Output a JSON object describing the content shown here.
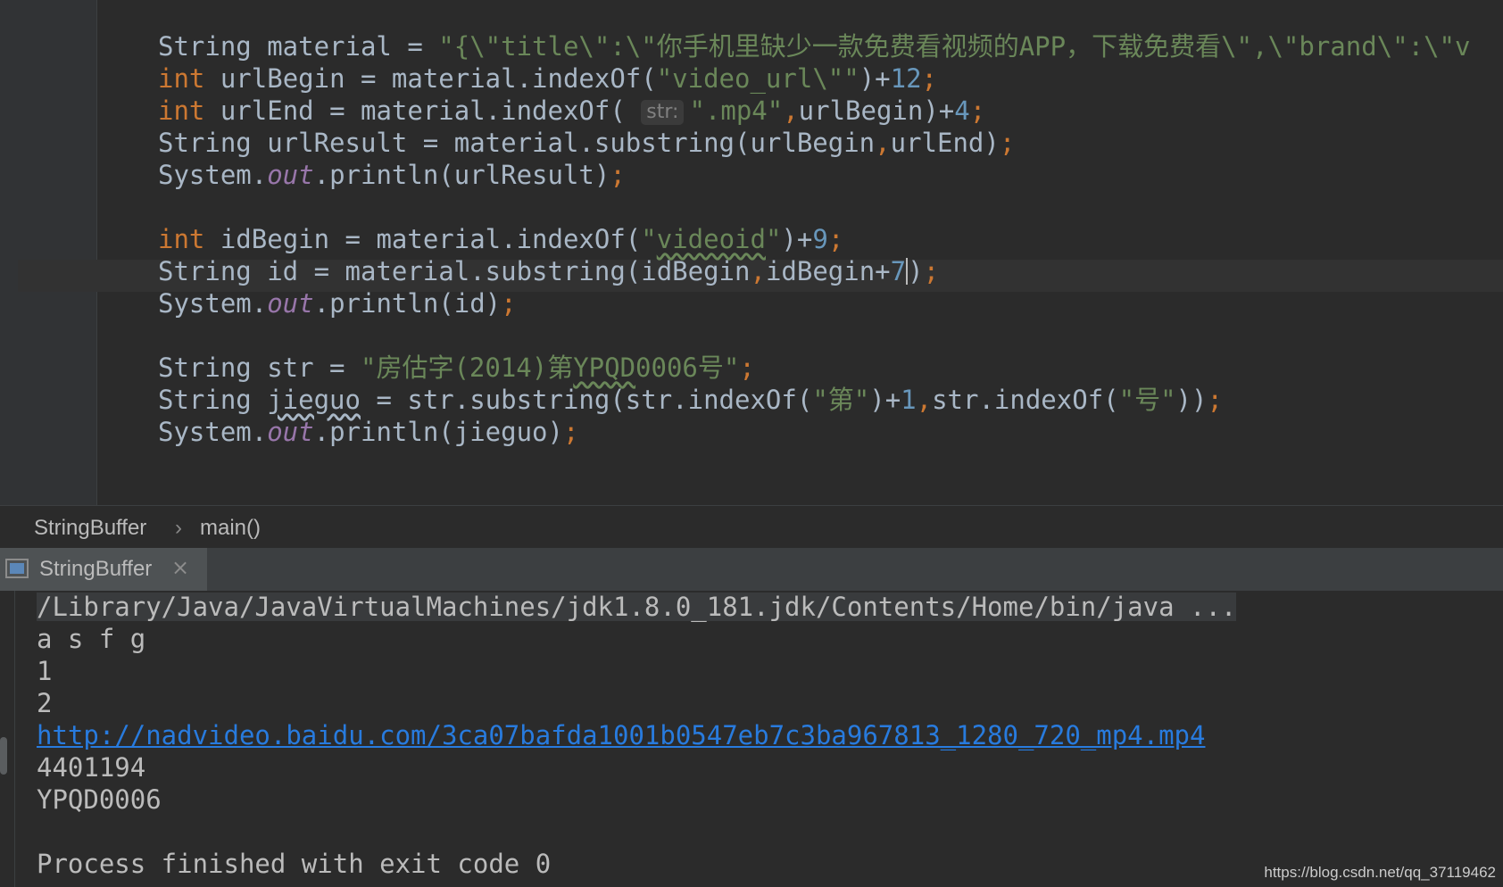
{
  "editor": {
    "code_lines": [
      {
        "parts": [
          [
            "t",
            "String material = "
          ],
          [
            "s",
            "\"{\\\"title\\\":\\\"你手机里缺少一款免费看视频的APP，下载免费看\\\",\\\"brand\\\":\\\"v"
          ]
        ]
      },
      {
        "parts": [
          [
            "k",
            "int"
          ],
          [
            "t",
            " urlBegin = material.indexOf("
          ],
          [
            "s",
            "\"video_url\\\"\""
          ],
          [
            "t",
            ")+"
          ],
          [
            "n",
            "12"
          ],
          [
            "p",
            ";"
          ]
        ]
      },
      {
        "parts": [
          [
            "k",
            "int"
          ],
          [
            "t",
            " urlEnd = material.indexOf( "
          ],
          [
            "h",
            "str:"
          ],
          [
            "s",
            "\".mp4\""
          ],
          [
            "p",
            ","
          ],
          [
            "t",
            "urlBegin)+"
          ],
          [
            "n",
            "4"
          ],
          [
            "p",
            ";"
          ]
        ]
      },
      {
        "parts": [
          [
            "t",
            "String urlResult = material.substring(urlBegin"
          ],
          [
            "p",
            ","
          ],
          [
            "t",
            "urlEnd)"
          ],
          [
            "p",
            ";"
          ]
        ]
      },
      {
        "parts": [
          [
            "t",
            "System."
          ],
          [
            "f",
            "out"
          ],
          [
            "t",
            ".println(urlResult)"
          ],
          [
            "p",
            ";"
          ]
        ]
      },
      {
        "parts": []
      },
      {
        "parts": [
          [
            "k",
            "int"
          ],
          [
            "t",
            " idBegin = material.indexOf("
          ],
          [
            "s",
            "\""
          ],
          [
            "sq",
            "videoid"
          ],
          [
            "s",
            "\""
          ],
          [
            "t",
            ")+"
          ],
          [
            "n",
            "9"
          ],
          [
            "p",
            ";"
          ]
        ]
      },
      {
        "parts": [
          [
            "t",
            "String id = material.substring(idBegin"
          ],
          [
            "p",
            ","
          ],
          [
            "t",
            "idBegin+"
          ],
          [
            "n",
            "7"
          ],
          [
            "c",
            ""
          ],
          [
            "t",
            ")"
          ],
          [
            "p",
            ";"
          ]
        ]
      },
      {
        "parts": [
          [
            "t",
            "System."
          ],
          [
            "f",
            "out"
          ],
          [
            "t",
            ".println(id)"
          ],
          [
            "p",
            ";"
          ]
        ]
      },
      {
        "parts": []
      },
      {
        "parts": [
          [
            "t",
            "String str = "
          ],
          [
            "s",
            "\"房估字(2014)第"
          ],
          [
            "sq",
            "YPQD"
          ],
          [
            "s",
            "0006号\""
          ],
          [
            "p",
            ";"
          ]
        ]
      },
      {
        "parts": [
          [
            "t",
            "String "
          ],
          [
            "tq",
            "jieguo"
          ],
          [
            "t",
            " = str.substring(str.indexOf("
          ],
          [
            "s",
            "\"第\""
          ],
          [
            "t",
            ")+"
          ],
          [
            "n",
            "1"
          ],
          [
            "p",
            ","
          ],
          [
            "t",
            "str.indexOf("
          ],
          [
            "s",
            "\"号\""
          ],
          [
            "t",
            "))"
          ],
          [
            "p",
            ";"
          ]
        ]
      },
      {
        "parts": [
          [
            "t",
            "System."
          ],
          [
            "f",
            "out"
          ],
          [
            "t",
            ".println(jieguo)"
          ],
          [
            "p",
            ";"
          ]
        ]
      }
    ]
  },
  "breadcrumb": {
    "class_name": "StringBuffer",
    "separator": "›",
    "method": "main()"
  },
  "run_panel": {
    "tab_label": "StringBuffer",
    "close_glyph": "×",
    "console_lines": [
      {
        "type": "cmd",
        "text": "/Library/Java/JavaVirtualMachines/jdk1.8.0_181.jdk/Contents/Home/bin/java ..."
      },
      {
        "type": "out",
        "text": "a s f g"
      },
      {
        "type": "out",
        "text": "1"
      },
      {
        "type": "out",
        "text": "2"
      },
      {
        "type": "link",
        "text": "http://nadvideo.baidu.com/3ca07bafda1001b0547eb7c3ba967813_1280_720_mp4.mp4"
      },
      {
        "type": "out",
        "text": "4401194"
      },
      {
        "type": "out",
        "text": "YPQD0006"
      },
      {
        "type": "out",
        "text": ""
      },
      {
        "type": "out",
        "text": "Process finished with exit code 0"
      }
    ]
  },
  "watermark": "https://blog.csdn.net/qq_37119462",
  "colors": {
    "keyword": "#cc7832",
    "string": "#6a8759",
    "number": "#6897bb",
    "field": "#9876aa",
    "text": "#a9b7c6",
    "link": "#287bde",
    "background": "#2b2b2b"
  }
}
